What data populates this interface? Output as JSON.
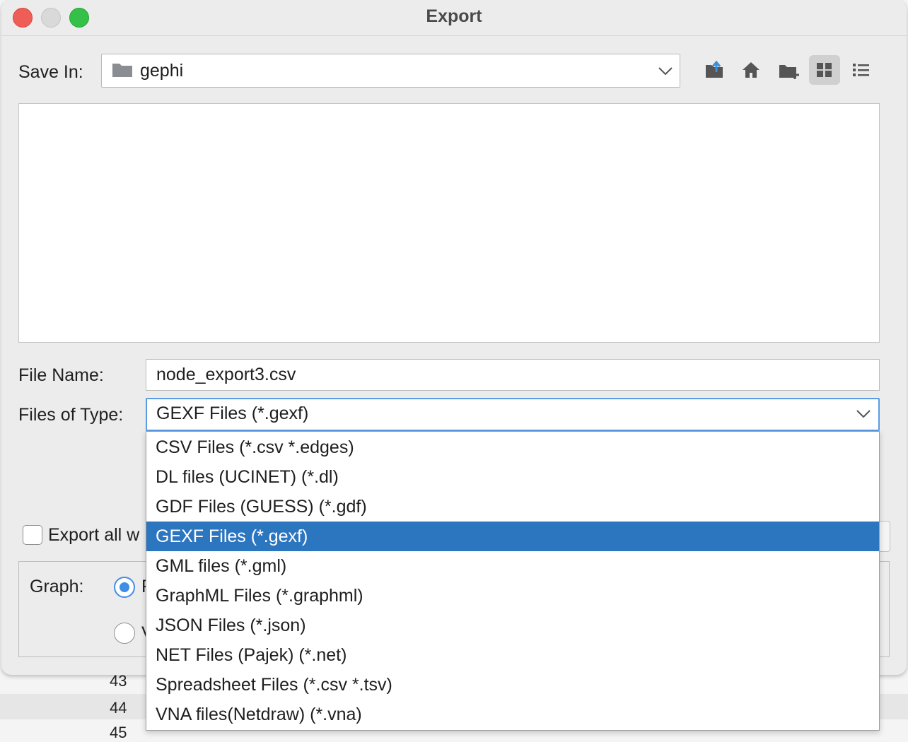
{
  "background": {
    "row_numbers": [
      "43",
      "44",
      "45"
    ]
  },
  "dialog": {
    "title": "Export",
    "save_in": {
      "label": "Save In:",
      "value": "gephi"
    },
    "toolbar": [
      "up-folder-icon",
      "home-icon",
      "new-folder-icon",
      "grid-view-icon",
      "list-view-icon"
    ],
    "file_name": {
      "label": "File Name:",
      "value": "node_export3.csv"
    },
    "files_of_type": {
      "label": "Files of Type:",
      "value": "GEXF Files (*.gexf)",
      "options": [
        "CSV Files (*.csv *.edges)",
        "DL files (UCINET) (*.dl)",
        "GDF Files (GUESS) (*.gdf)",
        "GEXF Files (*.gexf)",
        "GML files (*.gml)",
        "GraphML Files (*.graphml)",
        "JSON Files (*.json)",
        "NET Files (Pajek) (*.net)",
        "Spreadsheet Files (*.csv *.tsv)",
        "VNA files(Netdraw) (*.vna)"
      ],
      "selected_index": 3
    },
    "export_all": {
      "label": "Export all w",
      "checked": false
    },
    "graph": {
      "label": "Graph:",
      "option1": "F",
      "option2": "V"
    },
    "colors": {
      "accent": "#2c76c0",
      "radio": "#3f8ee8"
    }
  }
}
